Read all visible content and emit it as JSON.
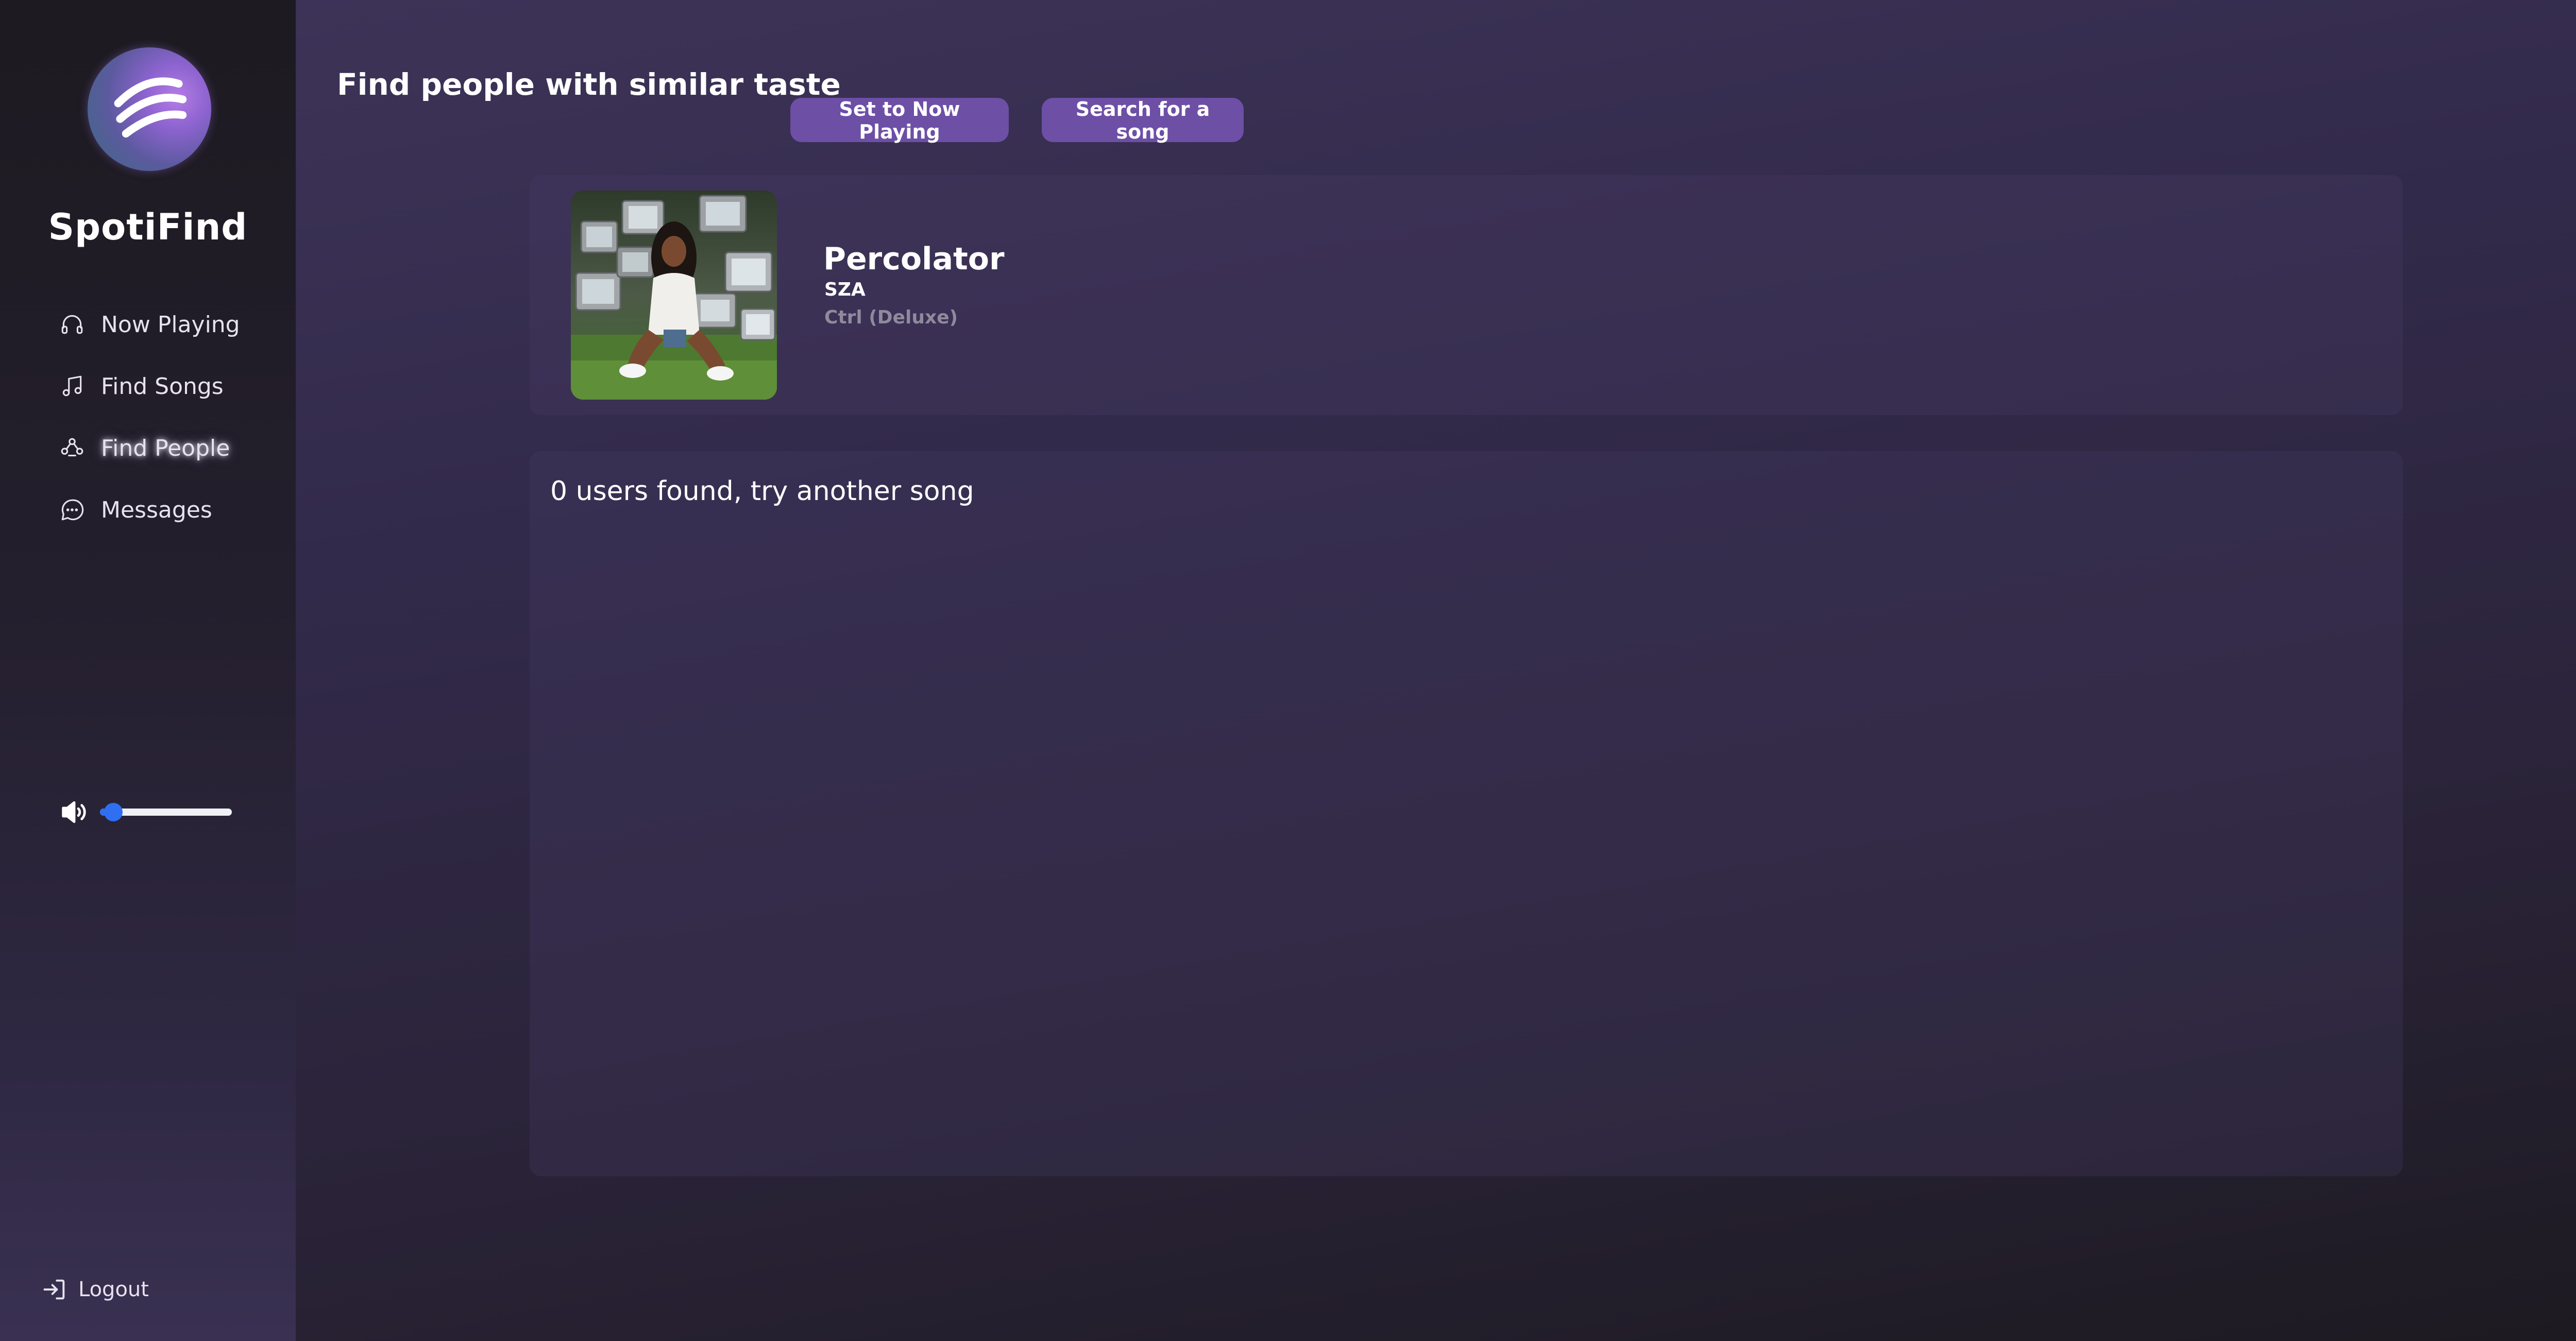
{
  "app": {
    "brand": "SpotiFind",
    "accent_color": "#6d4fa6",
    "slider_color": "#2f6ff2"
  },
  "sidebar": {
    "logo_icon": "wave-logo-icon",
    "items": [
      {
        "label": "Now Playing",
        "icon": "headphones-icon",
        "active": false
      },
      {
        "label": "Find Songs",
        "icon": "music-note-icon",
        "active": false
      },
      {
        "label": "Find People",
        "icon": "people-icon",
        "active": true
      },
      {
        "label": "Messages",
        "icon": "chat-bubble-icon",
        "active": false
      }
    ],
    "volume": {
      "icon": "speaker-icon",
      "level": 0.1
    },
    "logout_label": "Logout",
    "logout_icon": "logout-icon"
  },
  "main": {
    "title": "Find people with similar taste",
    "buttons": {
      "now_playing": "Set to Now Playing",
      "search": "Search for a song"
    },
    "song": {
      "title": "Percolator",
      "artist": "SZA",
      "album": "Ctrl (Deluxe)"
    },
    "results_message": "0 users found, try another song"
  }
}
